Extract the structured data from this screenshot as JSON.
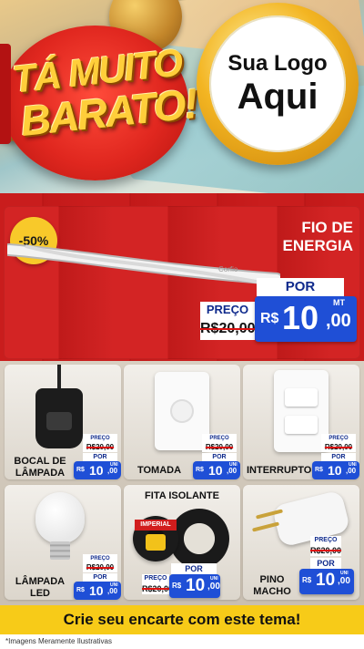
{
  "header": {
    "headline_line1": "TÁ MUITO",
    "headline_line2": "BARATO!",
    "logo_line1": "Sua Logo",
    "logo_line2": "Aqui"
  },
  "featured": {
    "discount": "-50%",
    "name_line1": "FIO DE",
    "name_line2": "ENERGIA",
    "cable_brand": "Corfio",
    "price_label": "PREÇO",
    "old_price": "R$20,00",
    "por_label": "POR",
    "currency": "R$",
    "price_int": "10",
    "price_dec": ",00",
    "unit": "MT"
  },
  "products": [
    {
      "name_line1": "BOCAL DE",
      "name_line2": "LÂMPADA",
      "price_label": "PREÇO",
      "old_price": "R$20,00",
      "por_label": "POR",
      "currency": "R$",
      "price_int": "10",
      "price_dec": ",00",
      "unit": "UNI"
    },
    {
      "name_line1": "TOMADA",
      "name_line2": "",
      "price_label": "PREÇO",
      "old_price": "R$20,00",
      "por_label": "POR",
      "currency": "R$",
      "price_int": "10",
      "price_dec": ",00",
      "unit": "UNI"
    },
    {
      "name_line1": "INTERRUPTOR",
      "name_line2": "",
      "price_label": "PREÇO",
      "old_price": "R$20,00",
      "por_label": "POR",
      "currency": "R$",
      "price_int": "10",
      "price_dec": ",00",
      "unit": "UNI"
    },
    {
      "name_line1": "LÂMPADA",
      "name_line2": "LED",
      "price_label": "PREÇO",
      "old_price": "R$20,00",
      "por_label": "POR",
      "currency": "R$",
      "price_int": "10",
      "price_dec": ",00",
      "unit": "UNI"
    },
    {
      "name_line1": "FITA ISOLANTE",
      "name_line2": "",
      "tape_brand": "IMPERIAL",
      "price_label": "PREÇO",
      "old_price": "R$20,00",
      "por_label": "POR",
      "currency": "R$",
      "price_int": "10",
      "price_dec": ",00",
      "unit": "UNI"
    },
    {
      "name_line1": "PINO",
      "name_line2": "MACHO",
      "price_label": "PREÇO",
      "old_price": "R$20,00",
      "por_label": "POR",
      "currency": "R$",
      "price_int": "10",
      "price_dec": ",00",
      "unit": "UNI"
    }
  ],
  "footer": {
    "cta": "Crie seu encarte com este tema!",
    "note": "*Imagens Meramente Ilustrativas"
  },
  "colors": {
    "red": "#d32424",
    "blue": "#1f4fd6",
    "yellow": "#f7cb18",
    "headline": "#ffce3a"
  }
}
